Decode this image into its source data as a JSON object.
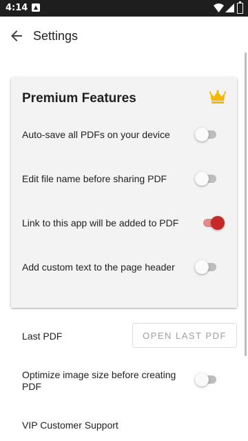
{
  "status_bar": {
    "time": "4:14"
  },
  "app_bar": {
    "title": "Settings"
  },
  "premium": {
    "title": "Premium Features",
    "rows": [
      {
        "label": "Auto-save all PDFs on your device",
        "enabled": false
      },
      {
        "label": "Edit file name before sharing PDF",
        "enabled": false
      },
      {
        "label": "Link to this app will be added to PDF",
        "enabled": true
      },
      {
        "label": "Add custom text to the page header",
        "enabled": false
      }
    ]
  },
  "settings": {
    "last_pdf_label": "Last PDF",
    "open_last_pdf_button": "OPEN LAST PDF",
    "optimize_label": "Optimize image size before creating PDF",
    "optimize_enabled": false,
    "vip_support_label": "VIP Customer Support"
  },
  "colors": {
    "accent": "#c62828",
    "crown": "#f5b800",
    "status_bar": "#1e1e1e"
  }
}
